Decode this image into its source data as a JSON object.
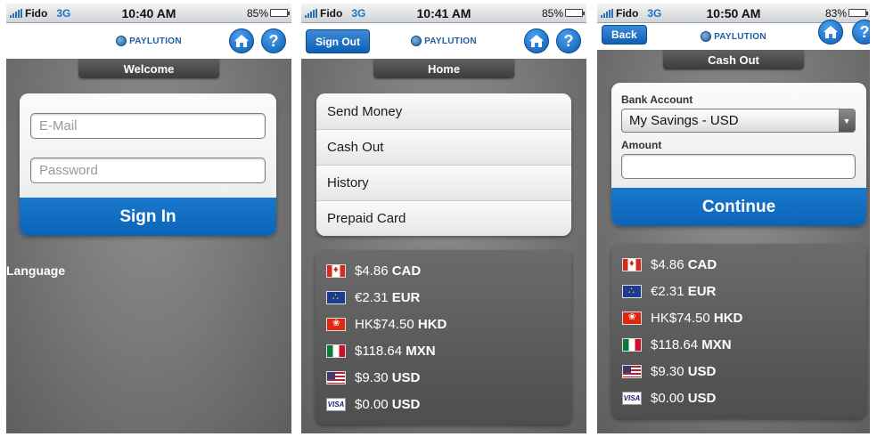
{
  "logo_text": "PAYLUTION",
  "screen1": {
    "status": {
      "carrier": "Fido",
      "network": "3G",
      "time": "10:40 AM",
      "battery": "85%",
      "battery_level": 0.85
    },
    "title": "Welcome",
    "email_placeholder": "E-Mail",
    "password_placeholder": "Password",
    "sign_in_label": "Sign In",
    "language_label": "Language"
  },
  "screen2": {
    "status": {
      "carrier": "Fido",
      "network": "3G",
      "time": "10:41 AM",
      "battery": "85%",
      "battery_level": 0.85
    },
    "sign_out_label": "Sign Out",
    "title": "Home",
    "menu": [
      {
        "label": "Send Money"
      },
      {
        "label": "Cash Out"
      },
      {
        "label": "History"
      },
      {
        "label": "Prepaid Card"
      }
    ],
    "balances": [
      {
        "flag": "canada-flag",
        "amount": "$4.86",
        "currency": "CAD"
      },
      {
        "flag": "eu-flag",
        "amount": "€2.31",
        "currency": "EUR"
      },
      {
        "flag": "hong-kong-flag",
        "amount": "HK$74.50",
        "currency": "HKD"
      },
      {
        "flag": "mexico-flag",
        "amount": "$118.64",
        "currency": "MXN"
      },
      {
        "flag": "us-flag",
        "amount": "$9.30",
        "currency": "USD"
      },
      {
        "flag": "visa-card",
        "amount": "$0.00",
        "currency": "USD"
      }
    ]
  },
  "screen3": {
    "status": {
      "carrier": "Fido",
      "network": "3G",
      "time": "10:50 AM",
      "battery": "83%",
      "battery_level": 0.83
    },
    "back_label": "Back",
    "title": "Cash Out",
    "bank_account_label": "Bank Account",
    "bank_account_value": "My Savings - USD",
    "amount_label": "Amount",
    "amount_value": "",
    "continue_label": "Continue",
    "balances": [
      {
        "flag": "canada-flag",
        "amount": "$4.86",
        "currency": "CAD"
      },
      {
        "flag": "eu-flag",
        "amount": "€2.31",
        "currency": "EUR"
      },
      {
        "flag": "hong-kong-flag",
        "amount": "HK$74.50",
        "currency": "HKD"
      },
      {
        "flag": "mexico-flag",
        "amount": "$118.64",
        "currency": "MXN"
      },
      {
        "flag": "us-flag",
        "amount": "$9.30",
        "currency": "USD"
      },
      {
        "flag": "visa-card",
        "amount": "$0.00",
        "currency": "USD"
      }
    ]
  },
  "colors": {
    "primary_blue": "#0c63b5",
    "panel_dark": "#5a5a5a",
    "background_gray": "#7a7a7a"
  },
  "icons": {
    "home": "home-icon",
    "help": "help-icon",
    "select_arrow": "chevron-down-icon"
  }
}
